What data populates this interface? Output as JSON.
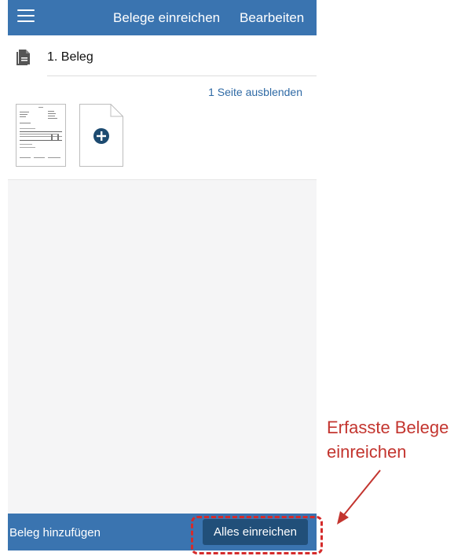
{
  "header": {
    "title": "Belege einreichen",
    "edit_label": "Bearbeiten",
    "menu_icon": "hamburger-menu-icon"
  },
  "beleg": {
    "title": "1. Beleg",
    "icon": "document-icon",
    "hide_pages_label": "1 Seite ausblenden",
    "add_page_icon": "plus-circle-icon"
  },
  "footer": {
    "add_label": "Beleg hinzufügen",
    "submit_label": "Alles einreichen"
  },
  "annotation": {
    "line1": "Erfasste Belege",
    "line2": "einreichen"
  },
  "colors": {
    "primary_bar": "#3a74b0",
    "submit_button": "#214f79",
    "annotation_red": "#c3352f"
  }
}
